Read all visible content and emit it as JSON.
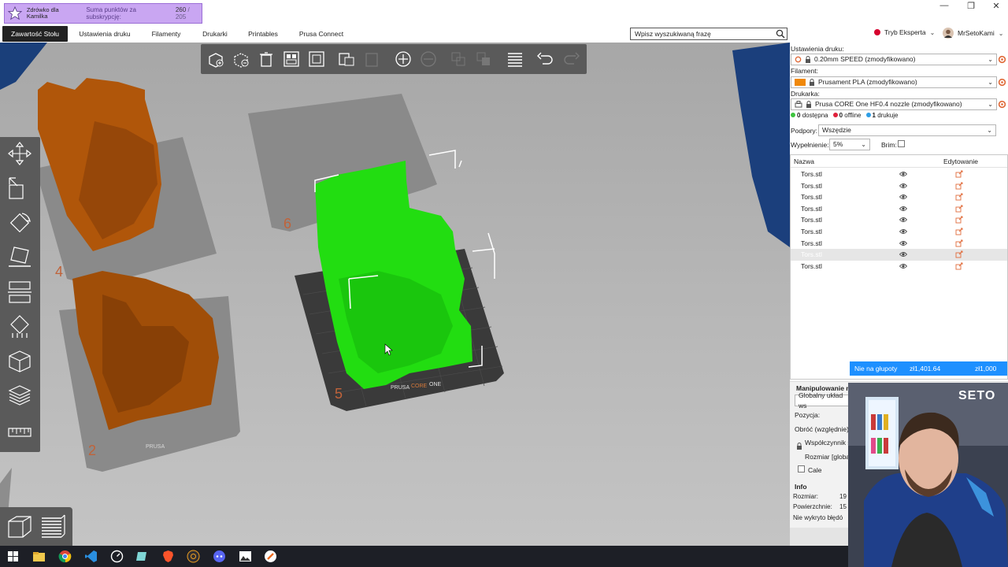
{
  "promo": {
    "name": "Zdrówko dla Kamilka",
    "label": "Suma punktów za subskrypcję:",
    "value": "260",
    "max": "/ 205"
  },
  "tabs": [
    {
      "label": "Zawartość Stołu",
      "active": true
    },
    {
      "label": "Ustawienia druku",
      "active": false
    },
    {
      "label": "Filamenty",
      "active": false
    },
    {
      "label": "Drukarki",
      "active": false
    },
    {
      "label": "Printables",
      "active": false
    },
    {
      "label": "Prusa Connect",
      "active": false
    }
  ],
  "search": {
    "placeholder": "Wpisz wyszukiwaną frazę"
  },
  "mode": {
    "label": "Tryb Eksperta"
  },
  "user": {
    "name": "MrSetoKami"
  },
  "sidebar": {
    "print_settings_label": "Ustawienia druku:",
    "print_settings_value": "0.20mm SPEED (zmodyfikowano)",
    "filament_label": "Filament:",
    "filament_value": "Prusament PLA (zmodyfikowano)",
    "filament_color": "#f0880a",
    "printer_label": "Drukarka:",
    "printer_value": "Prusa CORE One HF0.4 nozzle (zmodyfikowano)",
    "status": {
      "available_count": "0",
      "available_label": "dostępna",
      "offline_count": "0",
      "offline_label": "offline",
      "printing_count": "1",
      "printing_label": "drukuje"
    },
    "supports_label": "Podpory:",
    "supports_value": "Wszędzie",
    "infill_label": "Wypełnienie:",
    "infill_value": "5%",
    "brim_label": "Brim:",
    "brim_checked": false
  },
  "objects": {
    "col_name": "Nazwa",
    "col_edit": "Edytowanie",
    "rows": [
      {
        "name": "Tors.stl",
        "selected": false
      },
      {
        "name": "Tors.stl",
        "selected": false
      },
      {
        "name": "Tors.stl",
        "selected": false
      },
      {
        "name": "Tors.stl",
        "selected": false
      },
      {
        "name": "Tors.stl",
        "selected": false
      },
      {
        "name": "Tors.stl",
        "selected": false
      },
      {
        "name": "Tors.stl",
        "selected": false
      },
      {
        "name": "Tors.stl",
        "selected": true
      },
      {
        "name": "Tors.stl",
        "selected": false
      }
    ]
  },
  "pricebar": {
    "label": "Nie na głupoty",
    "value1": "zł1,401.64",
    "value2": "zł1,000"
  },
  "manip": {
    "title": "Manipulowanie m",
    "coord_system": "Globalny układ ws",
    "position_label": "Pozycja:",
    "rotate_label": "Obróć (względnie):",
    "scale_label": "Współczynnik s",
    "size_label": "Rozmiar [globa",
    "inches_label": "Cale"
  },
  "info": {
    "title": "Info",
    "size_label": "Rozmiar:",
    "size_value": "19",
    "surface_label": "Powierzchnie:",
    "surface_value": "15",
    "errors_label": "Nie wykryto błędó"
  },
  "webcam": {
    "overlay_text": "SETO"
  },
  "plates": {
    "numbers": [
      "4",
      "2",
      "6",
      "5"
    ],
    "brand": "PRUSA",
    "brand_model": "CORE",
    "brand_model2": "ONE"
  },
  "colors": {
    "accent": "#1e90ff",
    "selected_model": "#22dd11",
    "model": "#b0560a",
    "promo": "#c9a6f2"
  },
  "taskbar_icons": [
    "windows-icon",
    "file-explorer-icon",
    "chrome-icon",
    "vscode-icon",
    "speedtest-icon",
    "notes-icon",
    "brave-icon",
    "obs-icon",
    "chat-icon",
    "photos-icon",
    "prusaslicer-icon"
  ]
}
